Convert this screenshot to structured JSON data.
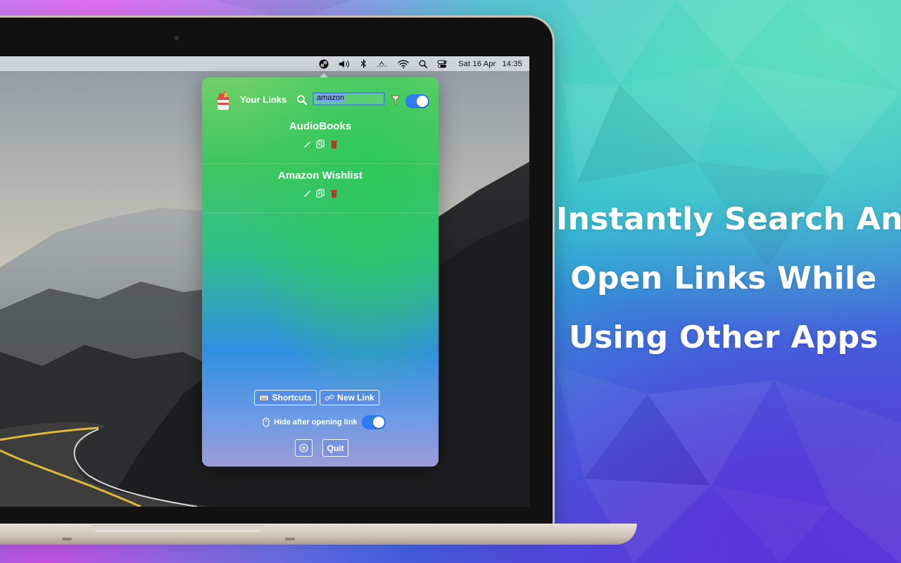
{
  "headline": {
    "lines": [
      "Instantly Search And",
      "Open Links While",
      "Using Other Apps"
    ]
  },
  "menubar": {
    "date": "Sat 16 Apr",
    "time": "14:35",
    "icons": [
      "link-app-icon",
      "volume-icon",
      "bluetooth-icon",
      "activity-icon",
      "wifi-icon",
      "search-icon",
      "control-center-icon"
    ]
  },
  "popover": {
    "title": "Your Links",
    "search": {
      "value": "amazon"
    },
    "filter_toggle_on": true,
    "links": [
      {
        "name": "AudioBooks"
      },
      {
        "name": "Amazon Wishlist"
      }
    ],
    "row_action_icons": [
      "edit-icon",
      "copy-icon",
      "delete-icon"
    ],
    "buttons": {
      "shortcuts": "Shortcuts",
      "new_link": "New Link",
      "quit": "Quit"
    },
    "hide_after_opening": {
      "label": "Hide after opening link",
      "on": true
    }
  },
  "colors": {
    "toggle_on": "#2d7cf6",
    "delete_icon": "#c0392b",
    "search_border": "#4b86e8"
  }
}
